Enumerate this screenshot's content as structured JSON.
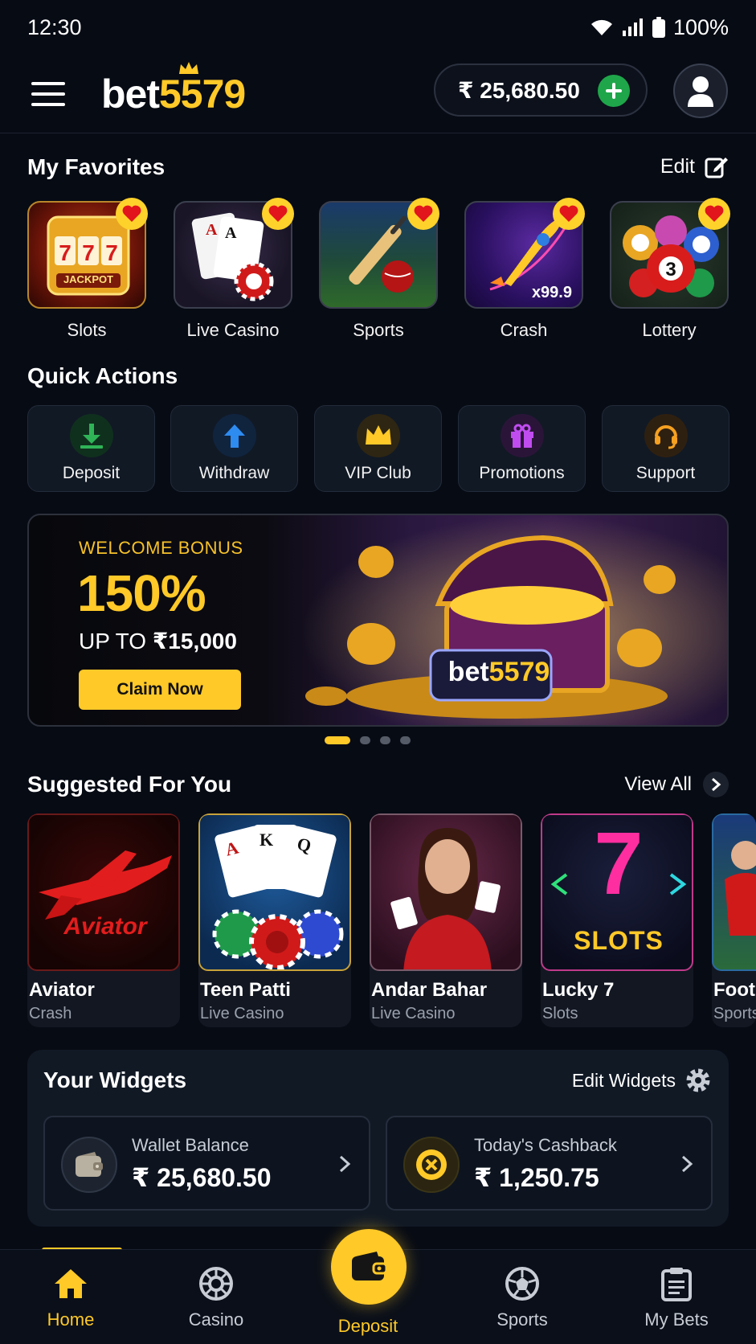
{
  "status_bar": {
    "time": "12:30",
    "battery": "100%"
  },
  "header": {
    "logo_main": "bet",
    "logo_accent": "5579",
    "balance": "₹ 25,680.50"
  },
  "favorites": {
    "title": "My Favorites",
    "edit_label": "Edit",
    "items": [
      {
        "label": "Slots"
      },
      {
        "label": "Live Casino"
      },
      {
        "label": "Sports"
      },
      {
        "label": "Crash",
        "badge": "x99.9"
      },
      {
        "label": "Lottery"
      }
    ],
    "slots_art_text": "JACKPOT"
  },
  "quick_actions": {
    "title": "Quick Actions",
    "items": [
      {
        "label": "Deposit",
        "icon": "download-icon",
        "color": "#2fb457"
      },
      {
        "label": "Withdraw",
        "icon": "upload-icon",
        "color": "#2e8bf0"
      },
      {
        "label": "VIP Club",
        "icon": "crown-icon",
        "color": "#ffc928"
      },
      {
        "label": "Promotions",
        "icon": "gift-icon",
        "color": "#c04cf0"
      },
      {
        "label": "Support",
        "icon": "headset-icon",
        "color": "#f5a020"
      }
    ]
  },
  "banner": {
    "kicker": "WELCOME BONUS",
    "headline": "150%",
    "upto_prefix": "UP TO ",
    "upto_amount": "₹15,000",
    "cta": "Claim Now",
    "chest_logo_main": "bet",
    "chest_logo_accent": "5579",
    "pages": 4,
    "active_page": 1
  },
  "suggested": {
    "title": "Suggested For You",
    "view_all": "View All",
    "games": [
      {
        "name": "Aviator",
        "category": "Crash",
        "art_text": "Aviator"
      },
      {
        "name": "Teen Patti",
        "category": "Live Casino"
      },
      {
        "name": "Andar Bahar",
        "category": "Live Casino"
      },
      {
        "name": "Lucky 7",
        "category": "Slots",
        "art_text": "SLOTS",
        "art_number": "7"
      },
      {
        "name": "Footb",
        "category": "Sports"
      }
    ]
  },
  "widgets": {
    "title": "Your Widgets",
    "edit_label": "Edit Widgets",
    "cards": [
      {
        "label": "Wallet Balance",
        "value": "₹ 25,680.50"
      },
      {
        "label": "Today's Cashback",
        "value": "₹ 1,250.75"
      }
    ]
  },
  "bottom_nav": {
    "items": [
      {
        "label": "Home",
        "active": true
      },
      {
        "label": "Casino"
      },
      {
        "label": "Deposit"
      },
      {
        "label": "Sports"
      },
      {
        "label": "My Bets"
      }
    ]
  },
  "colors": {
    "accent": "#ffc928",
    "background": "#070b14",
    "card": "#111925",
    "positive": "#1fa64a"
  }
}
